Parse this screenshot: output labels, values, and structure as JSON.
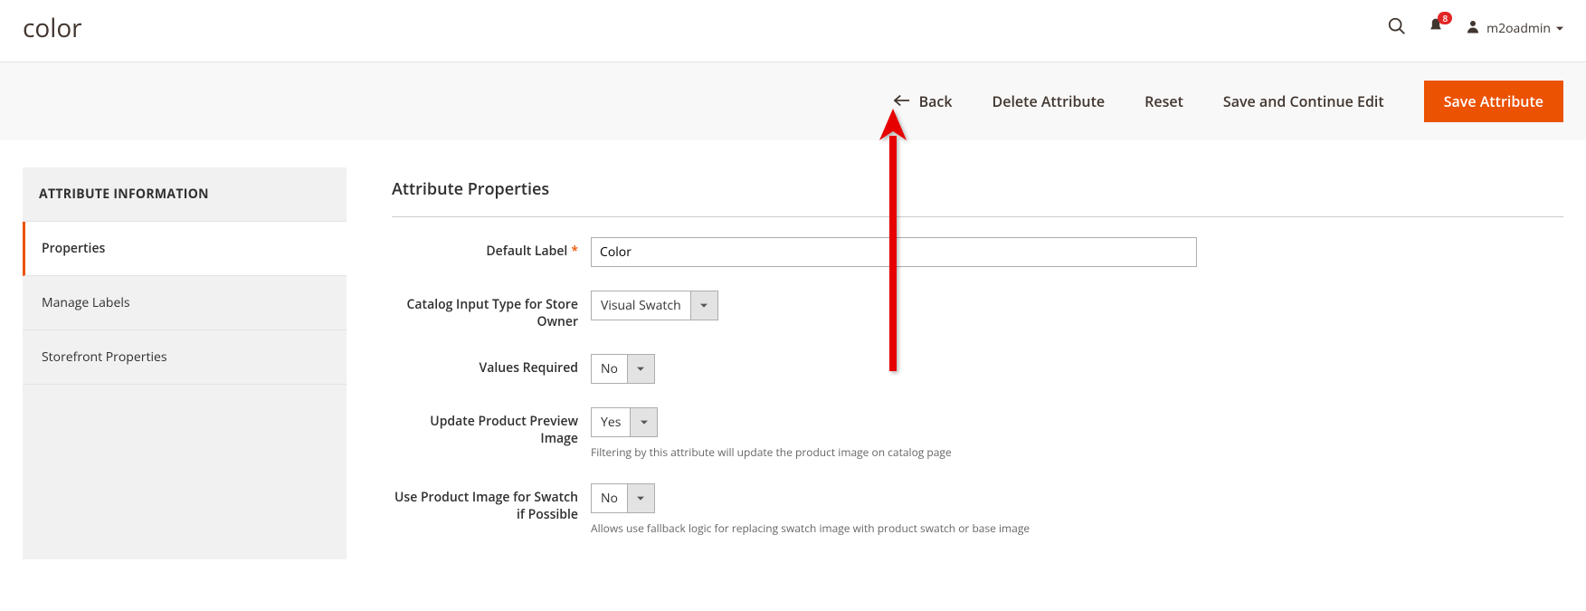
{
  "header": {
    "title": "color",
    "notif_count": "8",
    "username": "m2oadmin"
  },
  "actions": {
    "back": "Back",
    "delete": "Delete Attribute",
    "reset": "Reset",
    "save_continue": "Save and Continue Edit",
    "save": "Save Attribute"
  },
  "sidebar": {
    "title": "ATTRIBUTE INFORMATION",
    "items": [
      {
        "label": "Properties",
        "active": true
      },
      {
        "label": "Manage Labels",
        "active": false
      },
      {
        "label": "Storefront Properties",
        "active": false
      }
    ]
  },
  "form": {
    "section_title": "Attribute Properties",
    "fields": {
      "default_label": {
        "label": "Default Label",
        "value": "Color"
      },
      "input_type": {
        "label": "Catalog Input Type for Store Owner",
        "value": "Visual Swatch"
      },
      "values_required": {
        "label": "Values Required",
        "value": "No"
      },
      "update_preview": {
        "label": "Update Product Preview Image",
        "value": "Yes",
        "help": "Filtering by this attribute will update the product image on catalog page"
      },
      "use_product_image": {
        "label": "Use Product Image for Swatch if Possible",
        "value": "No",
        "help": "Allows use fallback logic for replacing swatch image with product swatch or base image"
      }
    }
  }
}
